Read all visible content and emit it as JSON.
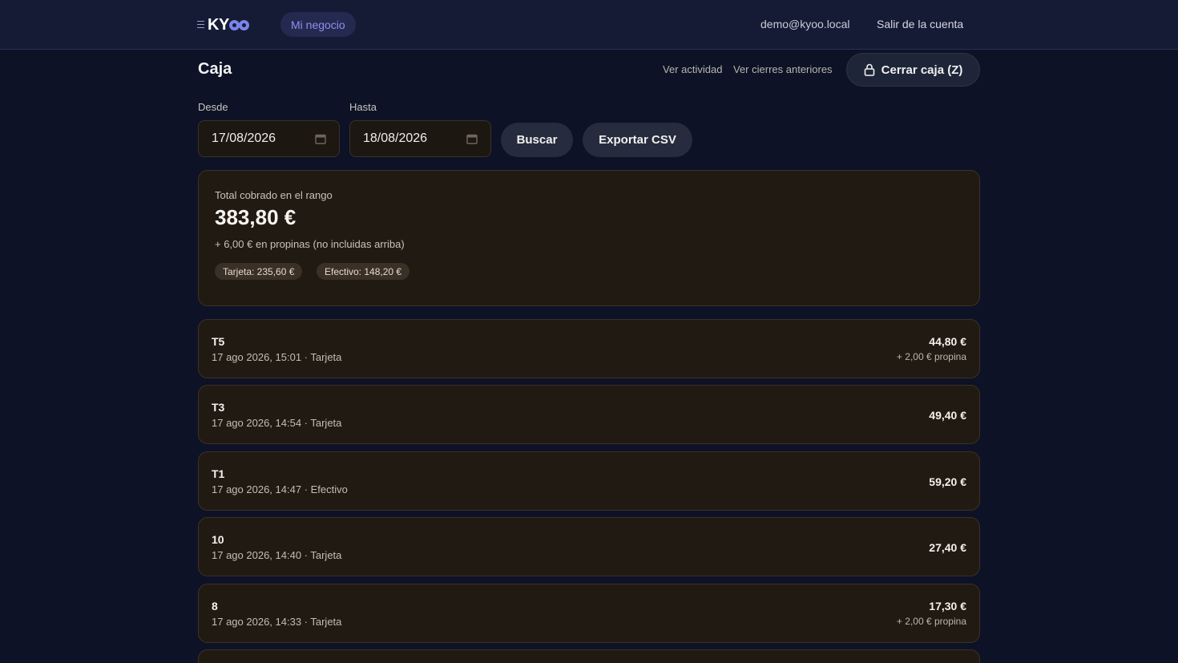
{
  "header": {
    "brand": "KY",
    "nav_item": "Mi negocio",
    "user_email": "demo@kyoo.local",
    "logout": "Salir de la cuenta"
  },
  "page": {
    "title": "Caja",
    "link_activity": "Ver actividad",
    "link_closures": "Ver cierres anteriores",
    "close_button": "Cerrar caja (Z)"
  },
  "filters": {
    "from_label": "Desde",
    "from_value": "17/08/2026",
    "to_label": "Hasta",
    "to_value": "18/08/2026",
    "search_button": "Buscar",
    "export_button": "Exportar CSV"
  },
  "summary": {
    "label": "Total cobrado en el rango",
    "total": "383,80 €",
    "tips": "+ 6,00 € en propinas (no incluidas arriba)",
    "card_badge": "Tarjeta: 235,60 €",
    "cash_badge": "Efectivo: 148,20 €"
  },
  "transactions": [
    {
      "title": "T5",
      "meta": "17 ago 2026, 15:01 · Tarjeta",
      "amount": "44,80 €",
      "tip": "+ 2,00 € propina"
    },
    {
      "title": "T3",
      "meta": "17 ago 2026, 14:54 · Tarjeta",
      "amount": "49,40 €",
      "tip": ""
    },
    {
      "title": "T1",
      "meta": "17 ago 2026, 14:47 · Efectivo",
      "amount": "59,20 €",
      "tip": ""
    },
    {
      "title": "10",
      "meta": "17 ago 2026, 14:40 · Tarjeta",
      "amount": "27,40 €",
      "tip": ""
    },
    {
      "title": "8",
      "meta": "17 ago 2026, 14:33 · Tarjeta",
      "amount": "17,30 €",
      "tip": "+ 2,00 € propina"
    }
  ],
  "colors": {
    "background": "#0d1226",
    "header": "#161b35",
    "card": "#211a12",
    "accent": "#8f8df0"
  }
}
